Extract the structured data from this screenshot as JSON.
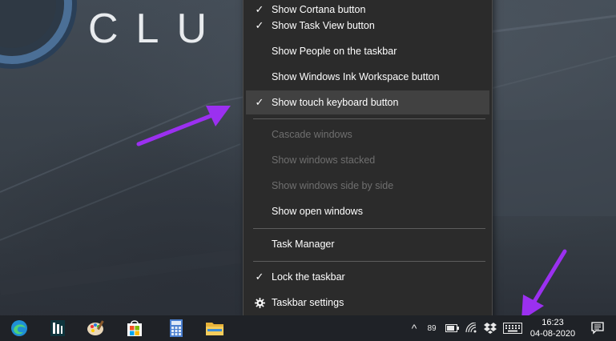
{
  "wallpaper": {
    "text": "CLU"
  },
  "context_menu": {
    "items": [
      {
        "label": "Show Cortana button",
        "checked": true,
        "disabled": false,
        "highlighted": false
      },
      {
        "label": "Show Task View button",
        "checked": true,
        "disabled": false,
        "highlighted": false
      },
      {
        "label": "Show People on the taskbar",
        "checked": false,
        "disabled": false,
        "highlighted": false
      },
      {
        "label": "Show Windows Ink Workspace button",
        "checked": false,
        "disabled": false,
        "highlighted": false
      },
      {
        "label": "Show touch keyboard button",
        "checked": true,
        "disabled": false,
        "highlighted": true
      },
      {
        "label": "Cascade windows",
        "checked": false,
        "disabled": true,
        "highlighted": false
      },
      {
        "label": "Show windows stacked",
        "checked": false,
        "disabled": true,
        "highlighted": false
      },
      {
        "label": "Show windows side by side",
        "checked": false,
        "disabled": true,
        "highlighted": false
      },
      {
        "label": "Show open windows",
        "checked": false,
        "disabled": false,
        "highlighted": false
      },
      {
        "label": "Task Manager",
        "checked": false,
        "disabled": false,
        "highlighted": false
      },
      {
        "label": "Lock the taskbar",
        "checked": true,
        "disabled": false,
        "highlighted": false
      },
      {
        "label": "Taskbar settings",
        "checked": false,
        "disabled": false,
        "highlighted": false,
        "icon": "gear-icon"
      }
    ],
    "check_glyph": "✓"
  },
  "taskbar": {
    "apps": [
      {
        "name": "edge-icon"
      },
      {
        "name": "dashlane-icon"
      },
      {
        "name": "paint-icon"
      },
      {
        "name": "microsoft-store-icon"
      },
      {
        "name": "calculator-icon"
      },
      {
        "name": "file-explorer-icon"
      }
    ],
    "tray": {
      "chevron": "^",
      "badge": "89",
      "icons": [
        "battery-icon",
        "wifi-icon",
        "dropbox-icon",
        "touch-keyboard-icon"
      ]
    },
    "clock": {
      "time": "16:23",
      "date": "04-08-2020"
    }
  },
  "colors": {
    "menu_bg": "#2b2b2b",
    "menu_highlight": "#414141",
    "menu_disabled_text": "#6f6f6f",
    "taskbar_bg": "#1f2227",
    "annotation_arrow": "#9b30f0"
  }
}
